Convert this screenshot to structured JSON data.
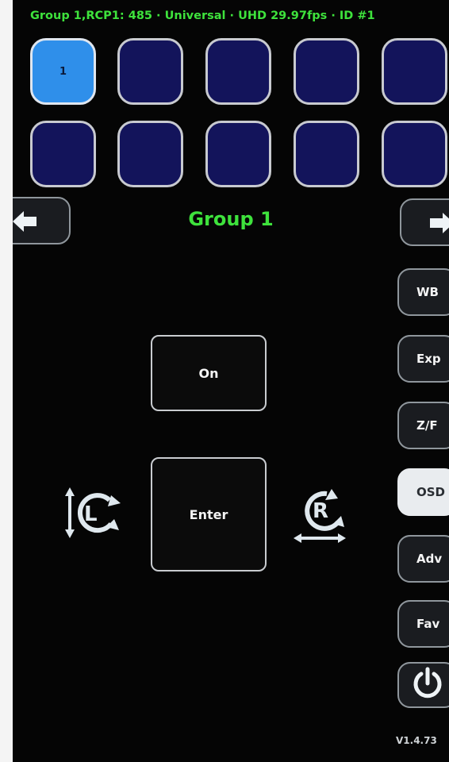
{
  "status_bar": {
    "text": "Group 1,RCP1: 485 · Universal · UHD 29.97fps · ID #1"
  },
  "camera_buttons": {
    "row1": [
      "1",
      "",
      "",
      "",
      ""
    ],
    "row2": [
      "",
      "",
      "",
      "",
      ""
    ],
    "selected": "1"
  },
  "group": {
    "title": "Group 1"
  },
  "navigation": {
    "prev_icon": "arrow-left-icon",
    "next_icon": "arrow-right-icon"
  },
  "side_menu": {
    "items": [
      {
        "label": "WB"
      },
      {
        "label": "Exp"
      },
      {
        "label": "Z/F"
      },
      {
        "label": "OSD",
        "active": true
      },
      {
        "label": "Adv"
      },
      {
        "label": "Fav"
      }
    ],
    "power_icon": "power-icon"
  },
  "center_controls": {
    "on_label": "On",
    "enter_label": "Enter",
    "left_rotary_letter": "L",
    "right_rotary_letter": "R",
    "left_rotary_icon": "rotary-left-vertical-icon",
    "right_rotary_icon": "rotary-right-horizontal-icon"
  },
  "version": "V1.4.73",
  "colors": {
    "accent_green": "#3ee23c",
    "selected_blue": "#2f8fea",
    "camera_navy": "#13145b"
  }
}
